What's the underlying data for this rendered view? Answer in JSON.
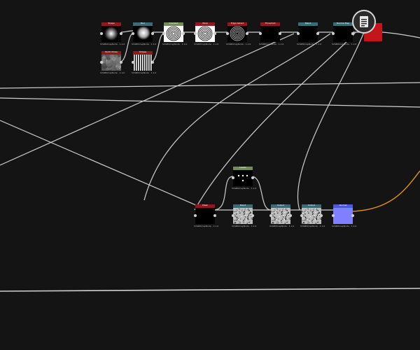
{
  "graph": {
    "nodes": [
      {
        "id": "n1",
        "title": "Shape",
        "caption": "SVGBitmapNode · 1.1.0",
        "header": "#8e1a1f",
        "preview": "blob"
      },
      {
        "id": "n2",
        "title": "Blur",
        "caption": "SVGBitmapNode · 1.1.0",
        "header": "#3c6a76",
        "preview": "blob-soft"
      },
      {
        "id": "n3",
        "title": "Gradient",
        "caption": "SVGBitmapNode · 1.1.0",
        "header": "#748c5a",
        "preview": "swirl"
      },
      {
        "id": "n4",
        "title": "Warp",
        "caption": "SVGBitmapNode · 1.1.0",
        "header": "#8e1a1f",
        "preview": "swirl"
      },
      {
        "id": "n5",
        "title": "Edge Detect",
        "caption": "SVGBitmapNode · 1.1.0",
        "header": "#8e1a1f",
        "preview": "swirl-dark"
      },
      {
        "id": "n6",
        "title": "Threshold",
        "caption": "SVGBitmapNode · 1.1.0",
        "header": "#8e1a1f",
        "preview": "black"
      },
      {
        "id": "n7",
        "title": "Blend",
        "caption": "SVGBitmapNode · 1.1.0",
        "header": "#3c6a76",
        "preview": "black"
      },
      {
        "id": "n8",
        "title": "Normal Map",
        "caption": "SVGBitmapNode · 1.1.0",
        "header": "#3c6a76",
        "preview": "black"
      },
      {
        "id": "n9",
        "title": "Perlin Noise",
        "caption": "SVGBitmapNode · 1.1.0",
        "header": "#8e1a1f",
        "preview": "noise"
      },
      {
        "id": "n10",
        "title": "Stripes",
        "caption": "SVGBitmapNode · 1.1.0",
        "header": "#8e1a1f",
        "preview": "stripes"
      },
      {
        "id": "n11",
        "title": "Levels",
        "caption": "SVGBitmapNode · 1.1.0",
        "header": "#748c5a",
        "preview": "dots"
      },
      {
        "id": "n12",
        "title": "Mask",
        "caption": "SVGBitmapNode · 1.1.0",
        "header": "#8e1a1f",
        "preview": "black"
      },
      {
        "id": "n13",
        "title": "Blend",
        "caption": "SVGBitmapNode · 1.1.0",
        "header": "#3c6a76",
        "preview": "grain"
      },
      {
        "id": "n14",
        "title": "Output",
        "caption": "SVGBitmapNode · 1.1.0",
        "header": "#3c6a76",
        "preview": "grain"
      },
      {
        "id": "n15",
        "title": "Output",
        "caption": "SVGBitmapNode · 1.1.0",
        "header": "#3c6a76",
        "preview": "grain"
      },
      {
        "id": "n16",
        "title": "Normal",
        "caption": "SVGBitmapNode · 1.1.0",
        "header": "#4a5ad8",
        "preview": "normal"
      }
    ]
  },
  "colors": {
    "background": "#141414",
    "wire": "#d9d9d9",
    "wire_output": "#e6951d",
    "badge_ring": "#d8d8d8",
    "accent_red": "#c3161c"
  },
  "icons": {
    "badge": "document-icon"
  }
}
